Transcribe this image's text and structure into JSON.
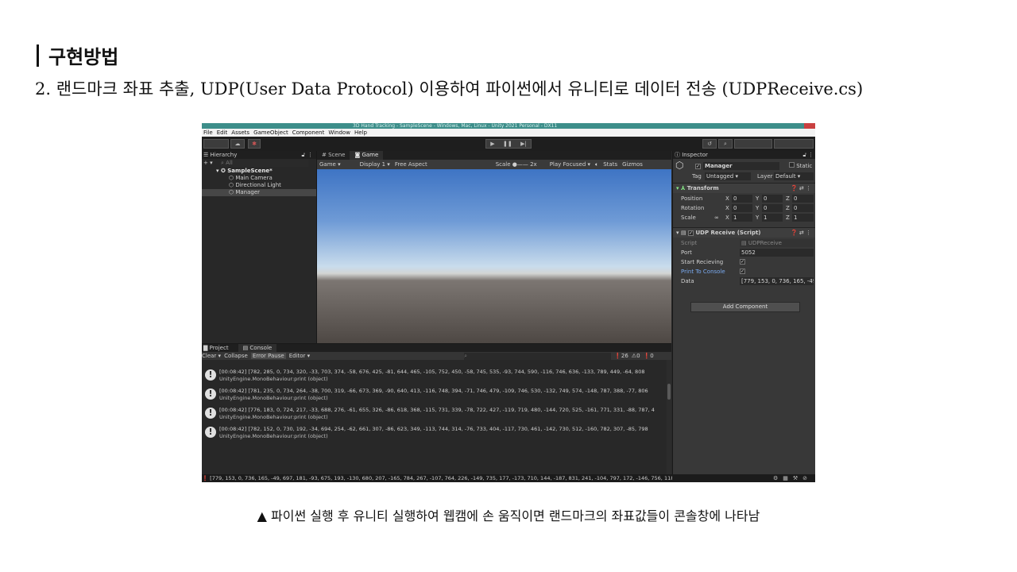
{
  "slide": {
    "heading": "구현방법",
    "subtitle": "2. 랜드마크 좌표 추출, UDP(User Data Protocol) 이용하여 파이썬에서 유니티로 데이터 전송 (UDPReceive.cs)",
    "caption": "▲ 파이썬 실행 후 유니티 실행하여 웹캠에 손 움직이면 랜드마크의 좌표값들이 콘솔창에 나타남"
  },
  "unity": {
    "window_title": "3D Hand Tracking - SampleScene - Windows, Mac, Linux - Unity 2021 Personal - DX11",
    "menu": [
      "File",
      "Edit",
      "Assets",
      "GameObject",
      "Component",
      "Window",
      "Help"
    ],
    "play_controls": [
      "▶",
      "❚❚",
      "▶|"
    ],
    "hierarchy": {
      "title": "Hierarchy",
      "search_placeholder": "All",
      "scene": "SampleScene*",
      "objects": [
        "Main Camera",
        "Directional Light",
        "Manager"
      ]
    },
    "scene_tabs": [
      "Scene",
      "Game"
    ],
    "game_bar": {
      "mode": "Game",
      "display": "Display 1",
      "aspect": "Free Aspect",
      "scale_label": "Scale",
      "scale_value": "2x",
      "play_mode": "Play Focused",
      "stats": "Stats",
      "gizmos": "Gizmos"
    },
    "inspector": {
      "title": "Inspector",
      "object_name": "Manager",
      "static_label": "Static",
      "tag_label": "Tag",
      "tag_value": "Untagged",
      "layer_label": "Layer",
      "layer_value": "Default",
      "transform": {
        "title": "Transform",
        "position_label": "Position",
        "rotation_label": "Rotation",
        "scale_label": "Scale",
        "position": [
          "0",
          "0",
          "0"
        ],
        "rotation": [
          "0",
          "0",
          "0"
        ],
        "scale": [
          "1",
          "1",
          "1"
        ]
      },
      "script_component": {
        "title": "UDP Receive (Script)",
        "script_label": "Script",
        "script_value": "UDPReceive",
        "port_label": "Port",
        "port_value": "5052",
        "start_label": "Start Recieving",
        "print_label": "Print To Console",
        "data_label": "Data",
        "data_value": "[779, 153, 0, 736, 165, -49,"
      },
      "add_component": "Add Component"
    },
    "console": {
      "tabs": [
        "Project",
        "Console"
      ],
      "toolbar": [
        "Clear",
        "Collapse",
        "Error Pause",
        "Editor ▾"
      ],
      "counts": {
        "logs": "26",
        "warnings": "0",
        "errors": "0"
      },
      "logs": [
        {
          "line1": "[00:08:42] [782, 285, 0, 734, 320, -33, 703, 374, -58, 676, 425, -81, 644, 465, -105, 752, 450, -58, 745, 535, -93, 744, 590, -116, 746, 636, -133, 789, 449, -64, 808",
          "line2": "UnityEngine.MonoBehaviour:print (object)"
        },
        {
          "line1": "[00:08:42] [781, 235, 0, 734, 264, -38, 700, 319, -66, 673, 369, -90, 640, 413, -116, 748, 394, -71, 746, 479, -109, 746, 530, -132, 749, 574, -148, 787, 388, -77, 806",
          "line2": "UnityEngine.MonoBehaviour:print (object)"
        },
        {
          "line1": "[00:08:42] [776, 183, 0, 724, 217, -33, 688, 276, -61, 655, 326, -86, 618, 368, -115, 731, 339, -78, 722, 427, -119, 719, 480, -144, 720, 525, -161, 771, 331, -88, 787, 4",
          "line2": "UnityEngine.MonoBehaviour:print (object)"
        },
        {
          "line1": "[00:08:42] [782, 152, 0, 730, 192, -34, 694, 254, -62, 661, 307, -86, 623, 349, -113, 744, 314, -76, 733, 404, -117, 730, 461, -142, 730, 512, -160, 782, 307, -85, 798",
          "line2": "UnityEngine.MonoBehaviour:print (object)"
        }
      ],
      "status": "[779, 153, 0, 736, 165, -49, 697, 181, -93, 675, 193, -130, 680, 207, -165, 784, 267, -107, 764, 226, -149, 735, 177, -173, 710, 144, -187, 831, 241, -104, 797, 172, -146, 756, 118, -158, 728, 83, -165, 862"
    }
  }
}
